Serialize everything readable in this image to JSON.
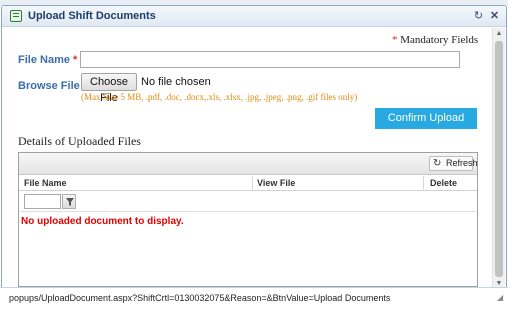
{
  "dialog": {
    "title": "Upload Shift Documents",
    "refresh_icon": "refresh-icon",
    "close_icon": "close-icon"
  },
  "form": {
    "mandatory_star": "*",
    "mandatory_text": "Mandatory Fields",
    "file_name_label": "File Name",
    "file_name_value": "",
    "browse_label": "Browse File",
    "required_mark": "*",
    "choose_file_button": "Choose File",
    "file_status": "No file chosen",
    "file_hint": "(Max Size 5 MB, .pdf, .doc, .docx,.xls, .xlsx, .jpg, .jpeg, .png, .gif files only)",
    "confirm_button": "Confirm Upload"
  },
  "uploaded": {
    "section_title": "Details of Uploaded Files",
    "refresh_label": "Refresh",
    "columns": [
      "File Name",
      "View File",
      "Delete"
    ],
    "filter_value": "",
    "empty_message": "No uploaded document to display."
  },
  "status": {
    "url": "popups/UploadDocument.aspx?ShiftCrtl=0130032075&Reason=&BtnValue=Upload Documents"
  },
  "colors": {
    "accent": "#29a9e1",
    "label": "#3a6ea5",
    "required": "#d32f2f",
    "hint": "#e08a10",
    "error": "#e00000"
  }
}
